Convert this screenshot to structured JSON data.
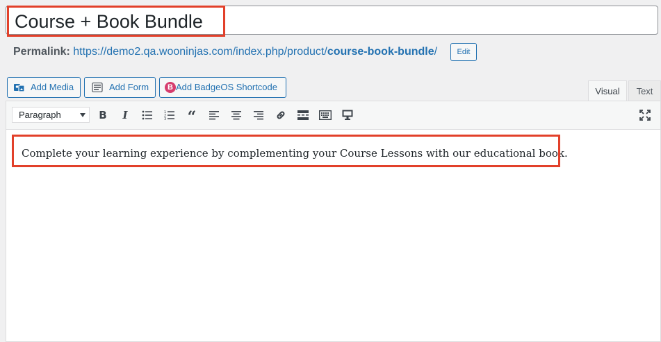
{
  "post": {
    "title": "Course + Book Bundle",
    "permalink_label": "Permalink:",
    "permalink_base": "https://demo2.qa.wooninjas.com/index.php/product/",
    "permalink_slug": "course-book-bundle",
    "permalink_trailing": "/",
    "edit_label": "Edit"
  },
  "media_buttons": {
    "add_media": "Add Media",
    "add_form": "Add Form",
    "add_badgeos": "Add BadgeOS Shortcode"
  },
  "editor_tabs": {
    "visual": "Visual",
    "text": "Text"
  },
  "toolbar": {
    "format_value": "Paragraph",
    "buttons": [
      "bold-icon",
      "italic-icon",
      "bullet-list-icon",
      "numbered-list-icon",
      "blockquote-icon",
      "align-left-icon",
      "align-center-icon",
      "align-right-icon",
      "link-icon",
      "read-more-icon",
      "toolbar-toggle-icon",
      "monitor-icon",
      "fullscreen-icon"
    ]
  },
  "editor": {
    "content": "Complete your learning experience by complementing your Course Lessons with our educational book."
  },
  "colors": {
    "accent": "#2271b1",
    "highlight": "#e2402a",
    "badgeos": "#d63d6e"
  }
}
